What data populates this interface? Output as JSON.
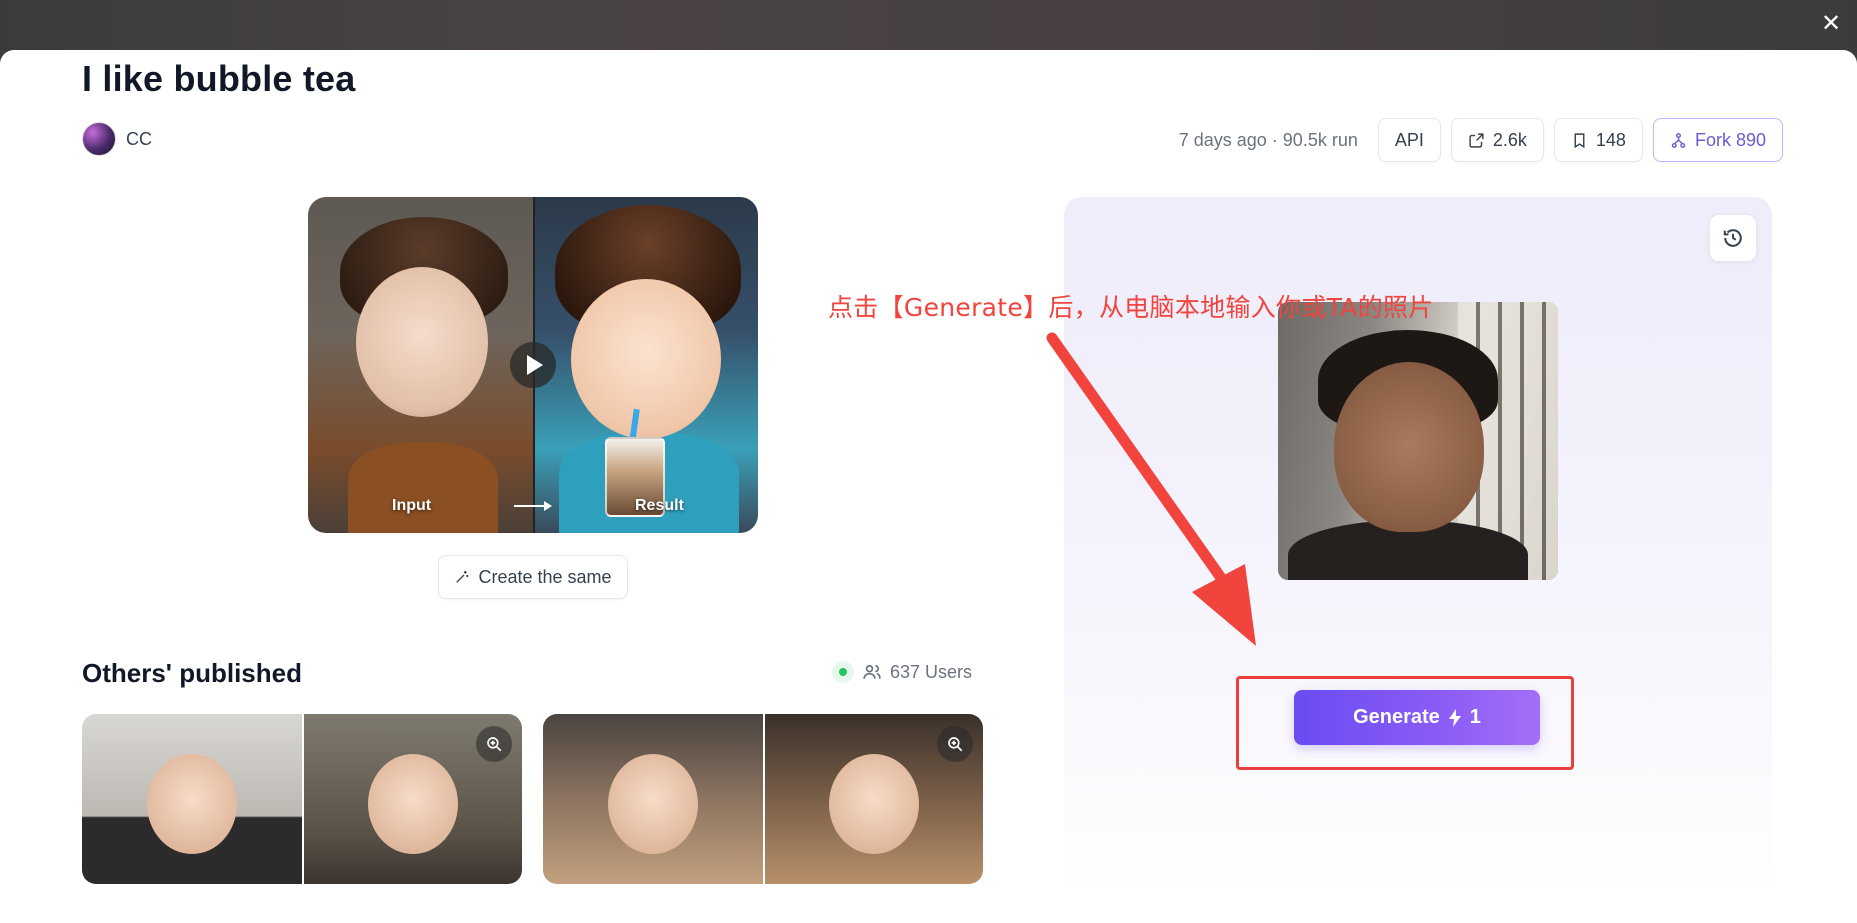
{
  "backdrop": {
    "close_icon": "close-icon"
  },
  "header": {
    "title": "I like bubble tea",
    "author": "CC",
    "meta": "7 days ago · 90.5k run",
    "api_label": "API",
    "share_count": "2.6k",
    "bookmark_count": "148",
    "fork_label": "Fork 890"
  },
  "preview": {
    "input_label": "Input",
    "result_label": "Result"
  },
  "create_same_label": "Create the same",
  "others": {
    "title": "Others' published",
    "users": "637 Users"
  },
  "annotation": {
    "text": "点击【Generate】后，从电脑本地输入你或TA的照片"
  },
  "generate": {
    "label": "Generate",
    "cost": "1"
  },
  "colors": {
    "accent": "#7c5cf6",
    "annotation_red": "#f0443d",
    "fork_purple": "#6d5bd0",
    "status_green": "#22c55e"
  }
}
